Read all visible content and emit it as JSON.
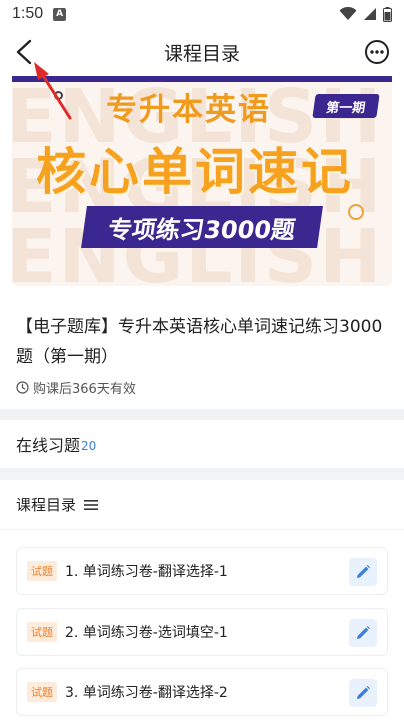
{
  "status": {
    "time": "1:50",
    "notification_letter": "A"
  },
  "nav": {
    "title": "课程目录"
  },
  "banner": {
    "bg_text": "ENGLISH",
    "line1": "专升本英语",
    "badge": "第一期",
    "line2": "核心单词速记",
    "pill": "专项练习3000题"
  },
  "course": {
    "title": "【电子题库】专升本英语核心单词速记练习3000题（第一期）",
    "validity": "购课后366天有效"
  },
  "practice": {
    "label": "在线习题",
    "count": "20"
  },
  "catalog": {
    "title": "课程目录",
    "items": [
      {
        "tag": "试题",
        "text": "1. 单词练习卷-翻译选择-1"
      },
      {
        "tag": "试题",
        "text": "2. 单词练习卷-选词填空-1"
      },
      {
        "tag": "试题",
        "text": "3. 单词练习卷-翻译选择-2"
      }
    ]
  },
  "colors": {
    "accent": "#3a2790",
    "orange": "#f7a21e",
    "link_blue": "#3b7fd8",
    "annotation_red": "#e02a2a"
  }
}
